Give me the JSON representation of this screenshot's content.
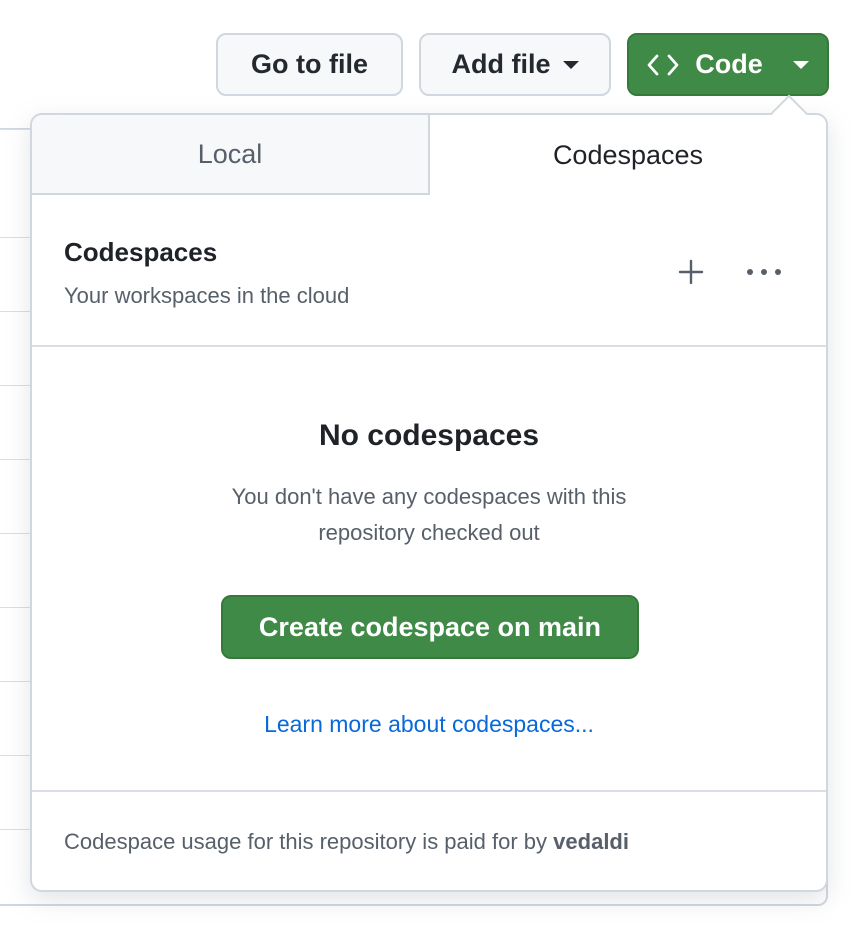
{
  "toolbar": {
    "go_to_file": "Go to file",
    "add_file": "Add file",
    "code": "Code"
  },
  "tabs": [
    {
      "label": "Local",
      "active": false
    },
    {
      "label": "Codespaces",
      "active": true
    }
  ],
  "codespaces": {
    "title": "Codespaces",
    "subtitle": "Your workspaces in the cloud",
    "empty_title": "No codespaces",
    "empty_description": "You don't have any codespaces with this repository checked out",
    "create_button": "Create codespace on main",
    "learn_more": "Learn more about codespaces...",
    "footer_prefix": "Codespace usage for this repository is paid for by",
    "footer_owner": "vedaldi"
  },
  "colors": {
    "primary_green": "#3f8a46",
    "link_blue": "#0969da",
    "muted_text": "#57606a",
    "border": "#d0d7de"
  },
  "icons": {
    "code": "code-brackets-icon",
    "caret": "triangle-down-icon",
    "plus": "plus-icon",
    "more": "kebab-horizontal-icon"
  }
}
